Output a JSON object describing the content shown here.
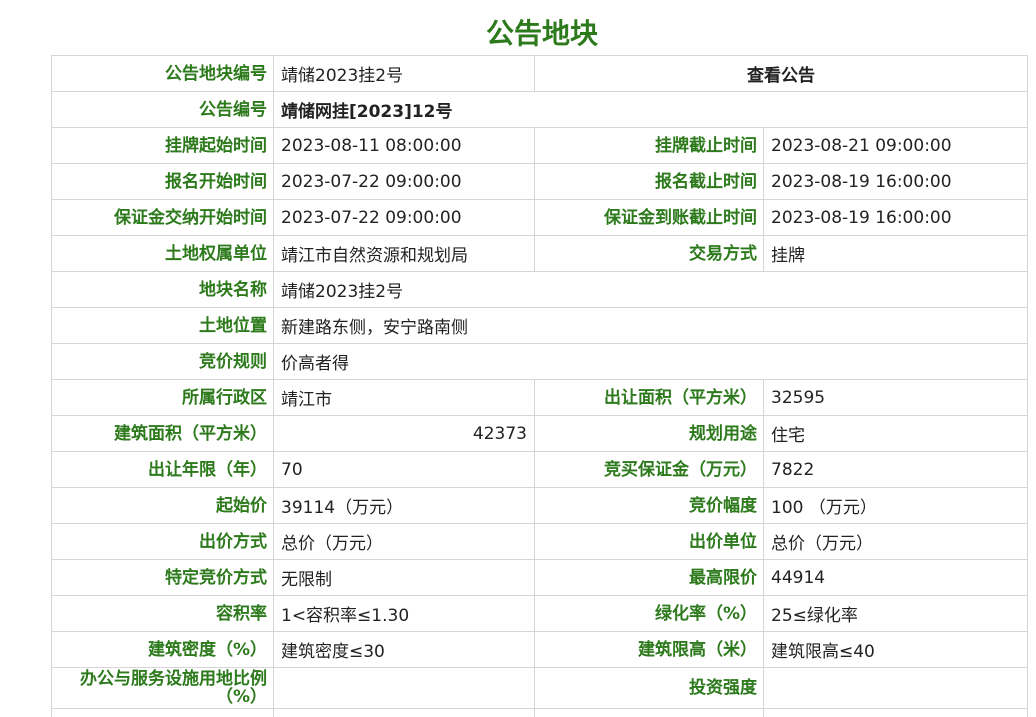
{
  "title": "公告地块",
  "rows": [
    {
      "l1": "公告地块编号",
      "v1": "靖储2023挂2号",
      "link": "查看公告"
    },
    {
      "l1": "公告编号",
      "v1": "靖储网挂[2023]12号"
    },
    {
      "l1": "挂牌起始时间",
      "v1": "2023-08-11 08:00:00",
      "l2": "挂牌截止时间",
      "v2": "2023-08-21 09:00:00"
    },
    {
      "l1": "报名开始时间",
      "v1": "2023-07-22 09:00:00",
      "l2": "报名截止时间",
      "v2": "2023-08-19 16:00:00"
    },
    {
      "l1": "保证金交纳开始时间",
      "v1": "2023-07-22 09:00:00",
      "l2": "保证金到账截止时间",
      "v2": "2023-08-19 16:00:00"
    },
    {
      "l1": "土地权属单位",
      "v1": "靖江市自然资源和规划局",
      "l2": "交易方式",
      "v2": "挂牌"
    },
    {
      "l1": "地块名称",
      "v1": "靖储2023挂2号"
    },
    {
      "l1": "土地位置",
      "v1": "新建路东侧，安宁路南侧"
    },
    {
      "l1": "竞价规则",
      "v1": "价高者得"
    },
    {
      "l1": "所属行政区",
      "v1": "靖江市",
      "l2": "出让面积（平方米）",
      "v2": "32595"
    },
    {
      "l1": "建筑面积（平方米）",
      "v1": "42373",
      "l2": "规划用途",
      "v2": "住宅"
    },
    {
      "l1": "出让年限（年）",
      "v1": "70",
      "l2": "竞买保证金（万元）",
      "v2": "7822"
    },
    {
      "l1": "起始价",
      "v1": "39114（万元）",
      "l2": "竞价幅度",
      "v2": "100 （万元）"
    },
    {
      "l1": "出价方式",
      "v1": "总价（万元）",
      "l2": "出价单位",
      "v2": "总价（万元）"
    },
    {
      "l1": "特定竞价方式",
      "v1": "无限制",
      "l2": "最高限价",
      "v2": "44914"
    },
    {
      "l1": "容积率",
      "v1": "1<容积率≤1.30",
      "l2": "绿化率（%）",
      "v2": "25≤绿化率"
    },
    {
      "l1": "建筑密度（%）",
      "v1": "建筑密度≤30",
      "l2": "建筑限高（米）",
      "v2": "建筑限高≤40"
    },
    {
      "l1": "办公与服务设施用地比例（%）",
      "v1": "",
      "l2": "投资强度",
      "v2": ""
    }
  ]
}
